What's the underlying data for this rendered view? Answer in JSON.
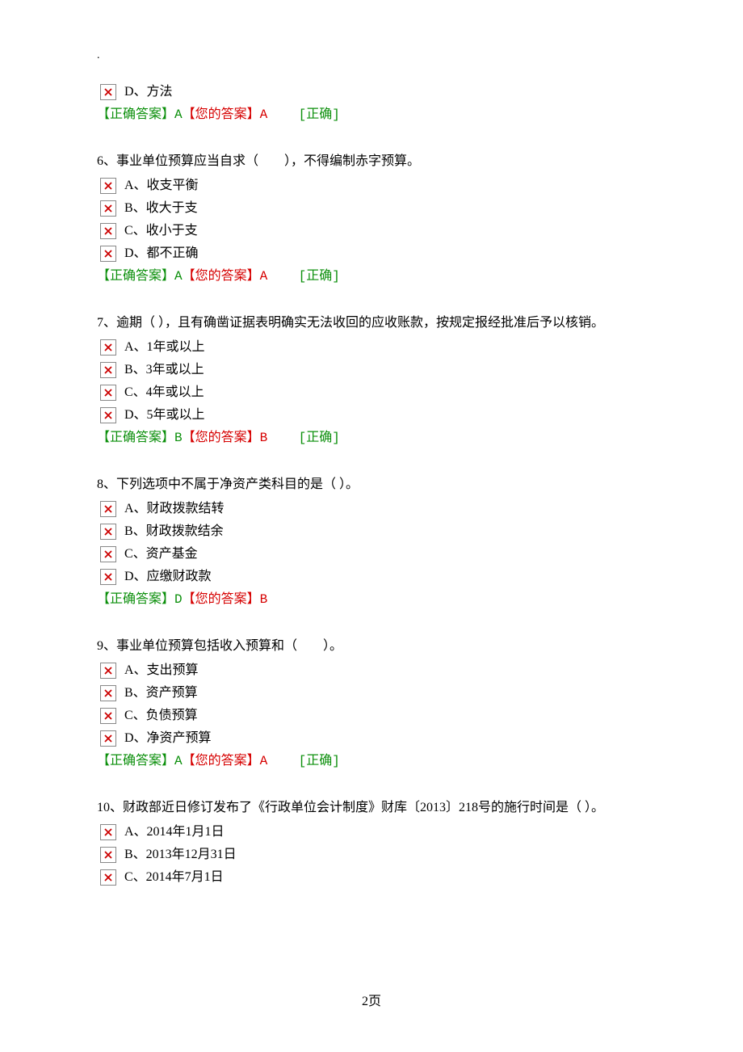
{
  "topDot": ".",
  "q5_tail_option": {
    "label": "D、方法"
  },
  "q5_answer": {
    "correct_label": "【正确答案】",
    "correct_value": "A",
    "your_label": "【您的答案】",
    "your_value": "A",
    "status": "[正确]"
  },
  "q6": {
    "text": "6、事业单位预算应当自求（　　），不得编制赤字预算。",
    "options": [
      "A、收支平衡",
      "B、收大于支",
      "C、收小于支",
      "D、都不正确"
    ],
    "answer": {
      "correct_label": "【正确答案】",
      "correct_value": "A",
      "your_label": "【您的答案】",
      "your_value": "A",
      "status": "[正确]"
    }
  },
  "q7": {
    "text": "7、逾期（ ），且有确凿证据表明确实无法收回的应收账款，按规定报经批准后予以核销。",
    "options": [
      "A、1年或以上",
      "B、3年或以上",
      "C、4年或以上",
      "D、5年或以上"
    ],
    "answer": {
      "correct_label": "【正确答案】",
      "correct_value": "B",
      "your_label": "【您的答案】",
      "your_value": "B",
      "status": "[正确]"
    }
  },
  "q8": {
    "text": "8、下列选项中不属于净资产类科目的是（  ）。",
    "options": [
      "A、财政拨款结转",
      "B、财政拨款结余",
      "C、资产基金",
      "D、应缴财政款"
    ],
    "answer": {
      "correct_label": "【正确答案】",
      "correct_value": "D",
      "your_label": "【您的答案】",
      "your_value": "B",
      "status": ""
    }
  },
  "q9": {
    "text": "9、事业单位预算包括收入预算和（　　）。",
    "options": [
      "A、支出预算",
      "B、资产预算",
      "C、负债预算",
      "D、净资产预算"
    ],
    "answer": {
      "correct_label": "【正确答案】",
      "correct_value": "A",
      "your_label": "【您的答案】",
      "your_value": "A",
      "status": "[正确]"
    }
  },
  "q10": {
    "text": "10、财政部近日修订发布了《行政单位会计制度》财库〔2013〕218号的施行时间是（ ）。",
    "options": [
      "A、2014年1月1日",
      "B、2013年12月31日",
      "C、2014年7月1日"
    ]
  },
  "footer": "2页"
}
